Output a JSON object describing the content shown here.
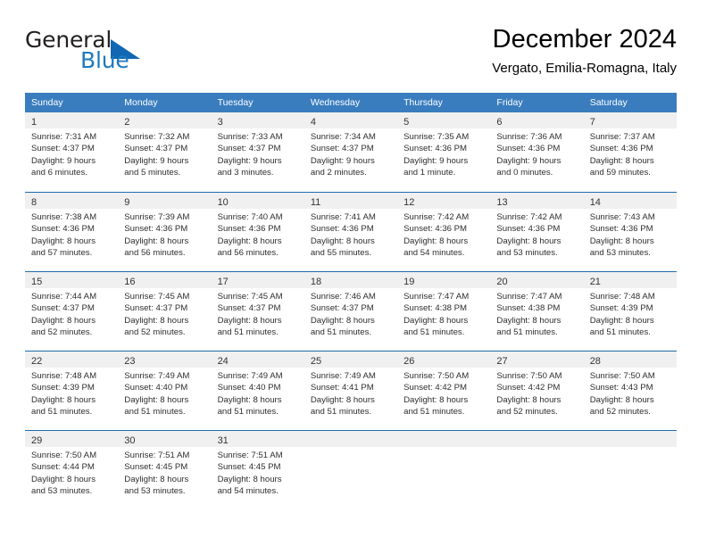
{
  "logo": {
    "word_top": "General",
    "word_bottom": "Blue",
    "triangle_color": "#1167b1",
    "blue_color": "#1c7ac0"
  },
  "header": {
    "title": "December 2024",
    "subtitle": "Vergato, Emilia-Romagna, Italy"
  },
  "theme": {
    "header_blue": "#3a7dbf",
    "row_divider_blue": "#1f6cad",
    "day_band_gray": "#f0f0f0"
  },
  "weekdays": [
    "Sunday",
    "Monday",
    "Tuesday",
    "Wednesday",
    "Thursday",
    "Friday",
    "Saturday"
  ],
  "weeks": [
    [
      {
        "day": "1",
        "sunrise": "Sunrise: 7:31 AM",
        "sunset": "Sunset: 4:37 PM",
        "daylight_1": "Daylight: 9 hours",
        "daylight_2": "and 6 minutes."
      },
      {
        "day": "2",
        "sunrise": "Sunrise: 7:32 AM",
        "sunset": "Sunset: 4:37 PM",
        "daylight_1": "Daylight: 9 hours",
        "daylight_2": "and 5 minutes."
      },
      {
        "day": "3",
        "sunrise": "Sunrise: 7:33 AM",
        "sunset": "Sunset: 4:37 PM",
        "daylight_1": "Daylight: 9 hours",
        "daylight_2": "and 3 minutes."
      },
      {
        "day": "4",
        "sunrise": "Sunrise: 7:34 AM",
        "sunset": "Sunset: 4:37 PM",
        "daylight_1": "Daylight: 9 hours",
        "daylight_2": "and 2 minutes."
      },
      {
        "day": "5",
        "sunrise": "Sunrise: 7:35 AM",
        "sunset": "Sunset: 4:36 PM",
        "daylight_1": "Daylight: 9 hours",
        "daylight_2": "and 1 minute."
      },
      {
        "day": "6",
        "sunrise": "Sunrise: 7:36 AM",
        "sunset": "Sunset: 4:36 PM",
        "daylight_1": "Daylight: 9 hours",
        "daylight_2": "and 0 minutes."
      },
      {
        "day": "7",
        "sunrise": "Sunrise: 7:37 AM",
        "sunset": "Sunset: 4:36 PM",
        "daylight_1": "Daylight: 8 hours",
        "daylight_2": "and 59 minutes."
      }
    ],
    [
      {
        "day": "8",
        "sunrise": "Sunrise: 7:38 AM",
        "sunset": "Sunset: 4:36 PM",
        "daylight_1": "Daylight: 8 hours",
        "daylight_2": "and 57 minutes."
      },
      {
        "day": "9",
        "sunrise": "Sunrise: 7:39 AM",
        "sunset": "Sunset: 4:36 PM",
        "daylight_1": "Daylight: 8 hours",
        "daylight_2": "and 56 minutes."
      },
      {
        "day": "10",
        "sunrise": "Sunrise: 7:40 AM",
        "sunset": "Sunset: 4:36 PM",
        "daylight_1": "Daylight: 8 hours",
        "daylight_2": "and 56 minutes."
      },
      {
        "day": "11",
        "sunrise": "Sunrise: 7:41 AM",
        "sunset": "Sunset: 4:36 PM",
        "daylight_1": "Daylight: 8 hours",
        "daylight_2": "and 55 minutes."
      },
      {
        "day": "12",
        "sunrise": "Sunrise: 7:42 AM",
        "sunset": "Sunset: 4:36 PM",
        "daylight_1": "Daylight: 8 hours",
        "daylight_2": "and 54 minutes."
      },
      {
        "day": "13",
        "sunrise": "Sunrise: 7:42 AM",
        "sunset": "Sunset: 4:36 PM",
        "daylight_1": "Daylight: 8 hours",
        "daylight_2": "and 53 minutes."
      },
      {
        "day": "14",
        "sunrise": "Sunrise: 7:43 AM",
        "sunset": "Sunset: 4:36 PM",
        "daylight_1": "Daylight: 8 hours",
        "daylight_2": "and 53 minutes."
      }
    ],
    [
      {
        "day": "15",
        "sunrise": "Sunrise: 7:44 AM",
        "sunset": "Sunset: 4:37 PM",
        "daylight_1": "Daylight: 8 hours",
        "daylight_2": "and 52 minutes."
      },
      {
        "day": "16",
        "sunrise": "Sunrise: 7:45 AM",
        "sunset": "Sunset: 4:37 PM",
        "daylight_1": "Daylight: 8 hours",
        "daylight_2": "and 52 minutes."
      },
      {
        "day": "17",
        "sunrise": "Sunrise: 7:45 AM",
        "sunset": "Sunset: 4:37 PM",
        "daylight_1": "Daylight: 8 hours",
        "daylight_2": "and 51 minutes."
      },
      {
        "day": "18",
        "sunrise": "Sunrise: 7:46 AM",
        "sunset": "Sunset: 4:37 PM",
        "daylight_1": "Daylight: 8 hours",
        "daylight_2": "and 51 minutes."
      },
      {
        "day": "19",
        "sunrise": "Sunrise: 7:47 AM",
        "sunset": "Sunset: 4:38 PM",
        "daylight_1": "Daylight: 8 hours",
        "daylight_2": "and 51 minutes."
      },
      {
        "day": "20",
        "sunrise": "Sunrise: 7:47 AM",
        "sunset": "Sunset: 4:38 PM",
        "daylight_1": "Daylight: 8 hours",
        "daylight_2": "and 51 minutes."
      },
      {
        "day": "21",
        "sunrise": "Sunrise: 7:48 AM",
        "sunset": "Sunset: 4:39 PM",
        "daylight_1": "Daylight: 8 hours",
        "daylight_2": "and 51 minutes."
      }
    ],
    [
      {
        "day": "22",
        "sunrise": "Sunrise: 7:48 AM",
        "sunset": "Sunset: 4:39 PM",
        "daylight_1": "Daylight: 8 hours",
        "daylight_2": "and 51 minutes."
      },
      {
        "day": "23",
        "sunrise": "Sunrise: 7:49 AM",
        "sunset": "Sunset: 4:40 PM",
        "daylight_1": "Daylight: 8 hours",
        "daylight_2": "and 51 minutes."
      },
      {
        "day": "24",
        "sunrise": "Sunrise: 7:49 AM",
        "sunset": "Sunset: 4:40 PM",
        "daylight_1": "Daylight: 8 hours",
        "daylight_2": "and 51 minutes."
      },
      {
        "day": "25",
        "sunrise": "Sunrise: 7:49 AM",
        "sunset": "Sunset: 4:41 PM",
        "daylight_1": "Daylight: 8 hours",
        "daylight_2": "and 51 minutes."
      },
      {
        "day": "26",
        "sunrise": "Sunrise: 7:50 AM",
        "sunset": "Sunset: 4:42 PM",
        "daylight_1": "Daylight: 8 hours",
        "daylight_2": "and 51 minutes."
      },
      {
        "day": "27",
        "sunrise": "Sunrise: 7:50 AM",
        "sunset": "Sunset: 4:42 PM",
        "daylight_1": "Daylight: 8 hours",
        "daylight_2": "and 52 minutes."
      },
      {
        "day": "28",
        "sunrise": "Sunrise: 7:50 AM",
        "sunset": "Sunset: 4:43 PM",
        "daylight_1": "Daylight: 8 hours",
        "daylight_2": "and 52 minutes."
      }
    ],
    [
      {
        "day": "29",
        "sunrise": "Sunrise: 7:50 AM",
        "sunset": "Sunset: 4:44 PM",
        "daylight_1": "Daylight: 8 hours",
        "daylight_2": "and 53 minutes."
      },
      {
        "day": "30",
        "sunrise": "Sunrise: 7:51 AM",
        "sunset": "Sunset: 4:45 PM",
        "daylight_1": "Daylight: 8 hours",
        "daylight_2": "and 53 minutes."
      },
      {
        "day": "31",
        "sunrise": "Sunrise: 7:51 AM",
        "sunset": "Sunset: 4:45 PM",
        "daylight_1": "Daylight: 8 hours",
        "daylight_2": "and 54 minutes."
      },
      {
        "day": "",
        "sunrise": "",
        "sunset": "",
        "daylight_1": "",
        "daylight_2": ""
      },
      {
        "day": "",
        "sunrise": "",
        "sunset": "",
        "daylight_1": "",
        "daylight_2": ""
      },
      {
        "day": "",
        "sunrise": "",
        "sunset": "",
        "daylight_1": "",
        "daylight_2": ""
      },
      {
        "day": "",
        "sunrise": "",
        "sunset": "",
        "daylight_1": "",
        "daylight_2": ""
      }
    ]
  ]
}
